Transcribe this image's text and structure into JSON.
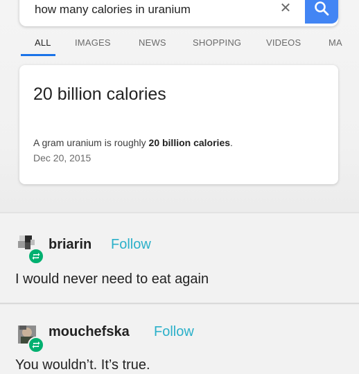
{
  "search": {
    "query": "how many calories in uranium",
    "clear_icon": "close-icon",
    "search_icon": "search-icon",
    "accent_color": "#4285f4"
  },
  "tabs": [
    {
      "label": "ALL",
      "active": true
    },
    {
      "label": "IMAGES",
      "active": false
    },
    {
      "label": "NEWS",
      "active": false
    },
    {
      "label": "SHOPPING",
      "active": false
    },
    {
      "label": "VIDEOS",
      "active": false
    },
    {
      "label": "MA",
      "active": false
    }
  ],
  "result": {
    "answer": "20 billion calories",
    "snippet_prefix": "A gram uranium is roughly ",
    "snippet_bold": "20 billion calories",
    "snippet_suffix": ".",
    "date": "Dec 20, 2015"
  },
  "posts": [
    {
      "username": "briarin",
      "follow_label": "Follow",
      "text": "I would never need to eat again",
      "badge_icon": "reblog-icon"
    },
    {
      "username": "mouchefska",
      "follow_label": "Follow",
      "text": "You wouldn’t. It’s true.",
      "badge_icon": "reblog-icon"
    }
  ],
  "colors": {
    "follow": "#2bb0c9",
    "reblog_badge": "#00b070",
    "tab_underline": "#1a73e8"
  }
}
